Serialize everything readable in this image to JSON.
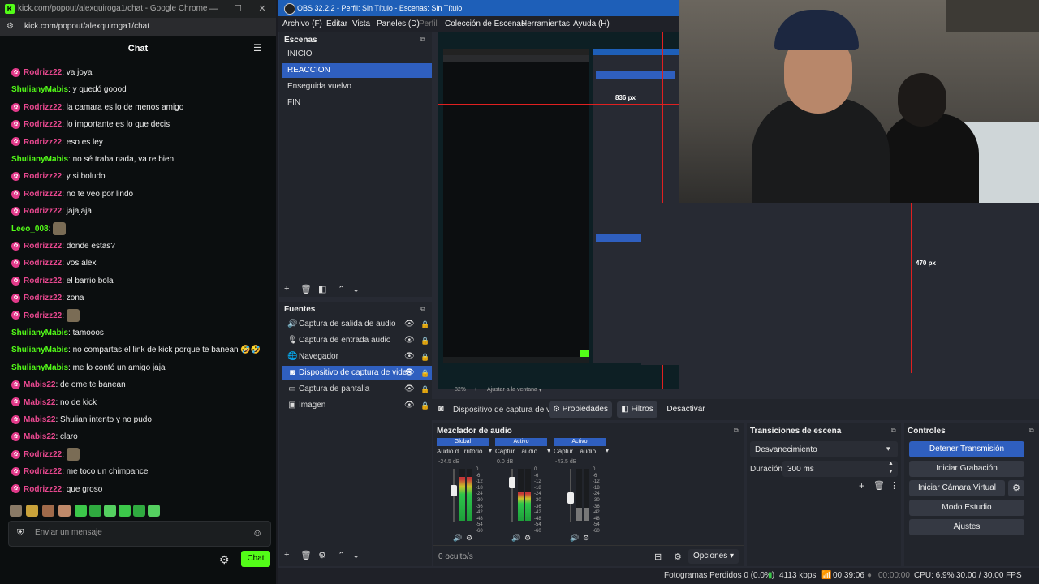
{
  "chrome": {
    "title": "kick.com/popout/alexquiroga1/chat - Google Chrome",
    "url": "kick.com/popout/alexquiroga1/chat",
    "chat_title": "Chat",
    "messages": [
      {
        "user": "Rodrizz22",
        "text": ": va joya",
        "color": "#e8488f",
        "badge": true
      },
      {
        "user": "ShulianyMabis",
        "text": ": y quedó goood",
        "color": "#53fc18",
        "badge": false
      },
      {
        "user": "Rodrizz22",
        "text": ": la camara es lo de menos amigo",
        "color": "#e8488f",
        "badge": true
      },
      {
        "user": "Rodrizz22",
        "text": ": lo importante es lo que decis",
        "color": "#e8488f",
        "badge": true
      },
      {
        "user": "Rodrizz22",
        "text": ": eso es ley",
        "color": "#e8488f",
        "badge": true
      },
      {
        "user": "ShulianyMabis",
        "text": ": no sé traba nada, va re bien",
        "color": "#53fc18",
        "badge": false
      },
      {
        "user": "Rodrizz22",
        "text": ": y si boludo",
        "color": "#e8488f",
        "badge": true
      },
      {
        "user": "Rodrizz22",
        "text": ": no te veo por lindo",
        "color": "#e8488f",
        "badge": true
      },
      {
        "user": "Rodrizz22",
        "text": ": jajajaja",
        "color": "#e8488f",
        "badge": true
      },
      {
        "user": "Leeo_008",
        "text": ":",
        "color": "#53fc18",
        "badge": false,
        "sticker": true
      },
      {
        "user": "Rodrizz22",
        "text": ": donde estas?",
        "color": "#e8488f",
        "badge": true
      },
      {
        "user": "Rodrizz22",
        "text": ": vos alex",
        "color": "#e8488f",
        "badge": true
      },
      {
        "user": "Rodrizz22",
        "text": ": el barrio bola",
        "color": "#e8488f",
        "badge": true
      },
      {
        "user": "Rodrizz22",
        "text": ": zona",
        "color": "#e8488f",
        "badge": true
      },
      {
        "user": "Rodrizz22",
        "text": ":",
        "color": "#e8488f",
        "badge": true,
        "sticker": true
      },
      {
        "user": "ShulianyMabis",
        "text": ": tamooos",
        "color": "#53fc18",
        "badge": false
      },
      {
        "user": "ShulianyMabis",
        "text": ": no compartas el link de kick porque te banean 🤣🤣",
        "color": "#53fc18",
        "badge": false
      },
      {
        "user": "ShulianyMabis",
        "text": ": me lo contó un amigo jaja",
        "color": "#53fc18",
        "badge": false
      },
      {
        "user": "Mabis22",
        "text": ": de ome te banean",
        "color": "#e8488f",
        "badge": true
      },
      {
        "user": "Mabis22",
        "text": ": no de kick",
        "color": "#e8488f",
        "badge": true
      },
      {
        "user": "Mabis22",
        "text": ": Shulian intento y no pudo",
        "color": "#e8488f",
        "badge": true
      },
      {
        "user": "Mabis22",
        "text": ": claro",
        "color": "#e8488f",
        "badge": true
      },
      {
        "user": "Rodrizz22",
        "text": ":",
        "color": "#e8488f",
        "badge": true,
        "sticker": true
      },
      {
        "user": "Rodrizz22",
        "text": ": me toco un chimpance",
        "color": "#e8488f",
        "badge": true
      },
      {
        "user": "Rodrizz22",
        "text": ": que groso",
        "color": "#e8488f",
        "badge": true
      }
    ],
    "input_placeholder": "Enviar un mensaje",
    "send_label": "Chat"
  },
  "obs": {
    "title": "OBS 32.2.2 - Perfil: Sin Título - Escenas: Sin Título",
    "menu": [
      "Archivo (F)",
      "Editar",
      "Vista",
      "Paneles (D)",
      "Perfil",
      "Colección de Escenas",
      "Herramientas",
      "Ayuda (H)"
    ],
    "scenes_header": "Escenas",
    "scenes": [
      "INICIO",
      "REACCION",
      "Enseguida vuelvo",
      "FIN"
    ],
    "selected_scene": 1,
    "sources_header": "Fuentes",
    "sources": [
      {
        "label": "Captura de salida de audio",
        "icon": "speaker-icon"
      },
      {
        "label": "Captura de entrada audio",
        "icon": "microphone-icon"
      },
      {
        "label": "Navegador",
        "icon": "globe-icon"
      },
      {
        "label": "Dispositivo de captura de video",
        "icon": "camera-icon"
      },
      {
        "label": "Captura de pantalla",
        "icon": "monitor-icon"
      },
      {
        "label": "Imagen",
        "icon": "image-icon"
      }
    ],
    "selected_source": 3,
    "preview": {
      "measure_top": "836 px",
      "measure_right": "470 px",
      "zoom": "82%",
      "fit": "Ajustar a la ventana"
    },
    "source_bar": {
      "name": "Dispositivo de captura de v",
      "properties": "Propiedades",
      "filters": "Filtros",
      "deactivate": "Desactivar"
    },
    "mixer": {
      "header": "Mezclador de audio",
      "channels": [
        {
          "tag": "Global",
          "name": "Audio d...rritorio",
          "db": "-24.5 dB",
          "level": 0.62
        },
        {
          "tag": "Activo",
          "name": "Captur... audio",
          "db": "0.0 dB",
          "level": 0.8
        },
        {
          "tag": "Activo",
          "name": "Captur... audio",
          "db": "-43.5 dB",
          "level": 0.45
        }
      ],
      "scale": [
        "0",
        "-6",
        "-12",
        "-18",
        "-24",
        "-30",
        "-36",
        "-42",
        "-48",
        "-54",
        "-60"
      ],
      "hidden": "0 oculto/s",
      "options": "Opciones"
    },
    "transitions": {
      "header": "Transiciones de escena",
      "selected": "Desvanecimiento",
      "duration_label": "Duración",
      "duration_value": "300 ms"
    },
    "controls": {
      "header": "Controles",
      "stop_stream": "Detener Transmisión",
      "start_record": "Iniciar Grabación",
      "virtual_cam": "Iniciar Cámara Virtual",
      "studio_mode": "Modo Estudio",
      "settings": "Ajustes"
    },
    "status": {
      "dropped": "Fotogramas Perdidos 0 (0.0%)",
      "bitrate": "4113 kbps",
      "stream_time": "00:39:06",
      "record_time": "00:00:00",
      "cpu": "CPU: 6.9%",
      "fps": "30.00 / 30.00 FPS"
    }
  }
}
